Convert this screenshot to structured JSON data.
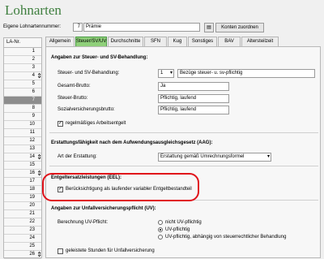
{
  "title": "Lohnarten",
  "top": {
    "own_label": "Eigene Lohnartennummer:",
    "code": "7",
    "name": "Prämie",
    "btn_tools": "▤",
    "konten_button": "Konten zuordnen"
  },
  "left": {
    "header": "LA-Nr.",
    "rows": [
      "1",
      "2",
      "3",
      "4",
      "5",
      "6",
      "7",
      "8",
      "9",
      "10",
      "11",
      "12",
      "13",
      "14",
      "15",
      "16",
      "17",
      "18",
      "19",
      "20",
      "21",
      "22",
      "23",
      "24",
      "25",
      "26"
    ],
    "selected": "7"
  },
  "tabs": [
    "Allgemein",
    "Steuer/SV/UV",
    "Durchschnitte",
    "SFN",
    "Kug",
    "Sonstiges",
    "BAV",
    "Altersteilzeit"
  ],
  "active_tab": "Steuer/SV/UV",
  "sections": {
    "steuer_sv": {
      "heading": "Angaben zur Steuer- und SV-Behandlung:",
      "steuer_sv_label": "Steuer- und SV-Behandlung:",
      "steuer_sv_code": "1",
      "steuer_sv_value": "Bezüge steuer- u. sv-pflichtig",
      "gesamt_label": "Gesamt-Brutto:",
      "gesamt_value": "Ja",
      "steuer_label": "Steuer-Brutto:",
      "steuer_value": "Pflichtig, laufend",
      "sv_label": "Sozialversicherungsbrutto:",
      "sv_value": "Pflichtig, laufend",
      "regel_label": "regelmäßiges Arbeitsentgelt"
    },
    "aag": {
      "heading": "Erstattungsfähigkeit nach dem Aufwendungsausgleichsgesetz (AAG):",
      "art_label": "Art der Erstattung:",
      "art_value": "Erstattung gemäß Umrechnungsformel"
    },
    "eel": {
      "heading": "Entgeltersatzleistungen (EEL):",
      "check_label": "Berücksichtigung als laufender variabler Entgeltbestandteil"
    },
    "uv": {
      "heading": "Angaben zur Unfallversicherungspflicht (UV):",
      "berechnung_label": "Berechnung UV-Pflicht:",
      "options": [
        "nicht UV-pflichtig",
        "UV-pflichtig",
        "UV-pflichtig, abhängig von steuerrechtlicher Behandlung"
      ],
      "selected_option": "UV-pflichtig",
      "geleistete_label": "geleistete Stunden für Unfallversicherung"
    }
  },
  "colors": {
    "accent_tab": "#8fd07a",
    "title": "#3f7f3f",
    "highlight": "#e0121a",
    "selected_row": "#8d8d8d"
  }
}
